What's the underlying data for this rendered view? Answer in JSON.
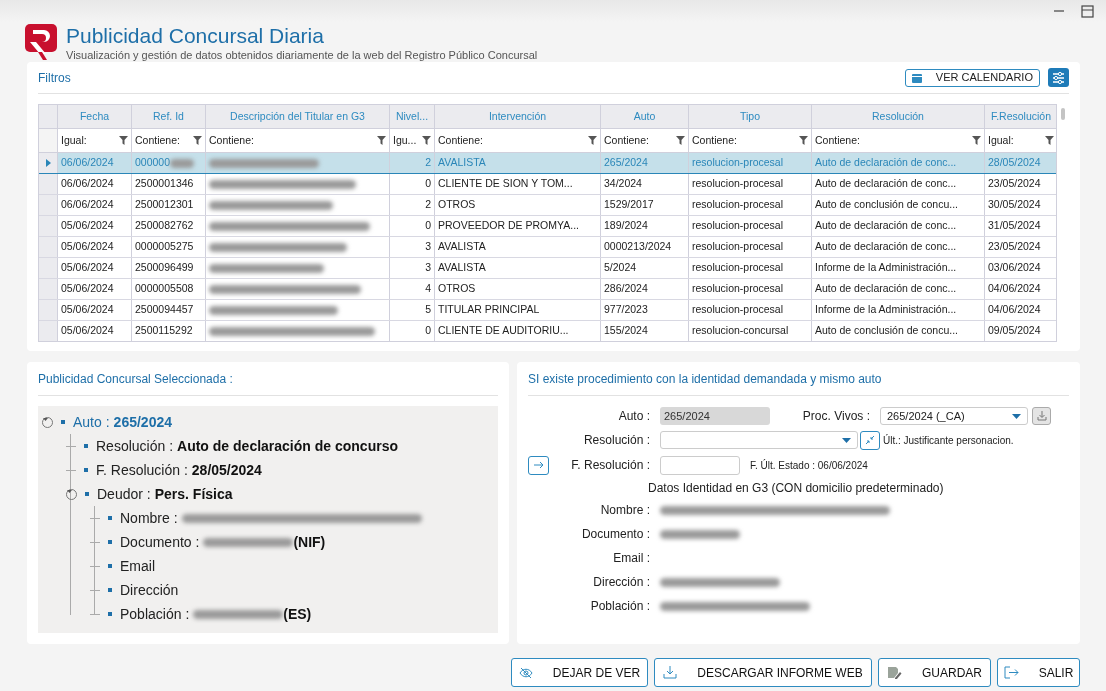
{
  "header": {
    "title": "Publicidad Concursal Diaria",
    "subtitle": "Visualización y gestión de datos obtenidos diariamente de la web del Registro Público Concursal"
  },
  "filters": {
    "title": "Filtros",
    "calendar_button": "VER CALENDARIO"
  },
  "table": {
    "columns": [
      {
        "label": "Fecha",
        "filter": "Igual:",
        "kind": "text"
      },
      {
        "label": "Ref. Id",
        "filter": "Contiene:",
        "kind": "text"
      },
      {
        "label": "Descripción del Titular en G3",
        "filter": "Contiene:",
        "kind": "redacted"
      },
      {
        "label": "Nivel...",
        "filter": "Igu...",
        "kind": "number"
      },
      {
        "label": "Intervención",
        "filter": "Contiene:",
        "kind": "text"
      },
      {
        "label": "Auto",
        "filter": "Contiene:",
        "kind": "text"
      },
      {
        "label": "Tipo",
        "filter": "Contiene:",
        "kind": "text"
      },
      {
        "label": "Resolución",
        "filter": "Contiene:",
        "kind": "text"
      },
      {
        "label": "F.Resolución",
        "filter": "Igual:",
        "kind": "text"
      }
    ],
    "rows": [
      {
        "selected": true,
        "ref_redacted": true,
        "cells": [
          "06/06/2024",
          "000000",
          null,
          "2",
          "AVALISTA",
          "265/2024",
          "resolucion-procesal",
          "Auto de declaración de conc...",
          "28/05/2024"
        ]
      },
      {
        "selected": false,
        "cells": [
          "06/06/2024",
          "2500001346",
          null,
          "0",
          "CLIENTE DE SION Y TOM...",
          "34/2024",
          "resolucion-procesal",
          "Auto de declaración de conc...",
          "23/05/2024"
        ]
      },
      {
        "selected": false,
        "cells": [
          "06/06/2024",
          "2500012301",
          null,
          "2",
          "OTROS",
          "1529/2017",
          "resolucion-procesal",
          "Auto de conclusión de concu...",
          "30/05/2024"
        ]
      },
      {
        "selected": false,
        "cells": [
          "05/06/2024",
          "2500082762",
          null,
          "0",
          "PROVEEDOR DE PROMYA...",
          "189/2024",
          "resolucion-procesal",
          "Auto de declaración de conc...",
          "31/05/2024"
        ]
      },
      {
        "selected": false,
        "cells": [
          "05/06/2024",
          "0000005275",
          null,
          "3",
          "AVALISTA",
          "0000213/2024",
          "resolucion-procesal",
          "Auto de declaración de conc...",
          "23/05/2024"
        ]
      },
      {
        "selected": false,
        "cells": [
          "05/06/2024",
          "2500096499",
          null,
          "3",
          "AVALISTA",
          "5/2024",
          "resolucion-procesal",
          "Informe de la Administración...",
          "03/06/2024"
        ]
      },
      {
        "selected": false,
        "cells": [
          "05/06/2024",
          "0000005508",
          null,
          "4",
          "OTROS",
          "286/2024",
          "resolucion-procesal",
          "Auto de declaración de conc...",
          "04/06/2024"
        ]
      },
      {
        "selected": false,
        "cells": [
          "05/06/2024",
          "2500094457",
          null,
          "5",
          "TITULAR PRINCIPAL",
          "977/2023",
          "resolucion-procesal",
          "Informe de la Administración...",
          "04/06/2024"
        ]
      },
      {
        "selected": false,
        "cells": [
          "05/06/2024",
          "2500115292",
          null,
          "0",
          "CLIENTE  DE  AUDITORIU...",
          "155/2024",
          "resolucion-concursal",
          "Auto de conclusión de concu...",
          "09/05/2024"
        ]
      }
    ]
  },
  "selected_panel": {
    "title": "Publicidad Concursal Seleccionada :",
    "tree": [
      {
        "label": "Auto :",
        "value": "265/2024",
        "expanded": true,
        "children": [
          {
            "label": "Resolución :",
            "value": "Auto de declaración de concurso"
          },
          {
            "label": "F. Resolución :",
            "value": "28/05/2024"
          },
          {
            "label": "Deudor :",
            "value": "Pers. Física",
            "expanded": true,
            "children": [
              {
                "label": "Nombre :",
                "redacted": true
              },
              {
                "label": "Documento :",
                "redacted": true,
                "value": "(NIF)"
              },
              {
                "label": "Email"
              },
              {
                "label": "Dirección"
              },
              {
                "label": "Población :",
                "redacted": true,
                "value": "(ES)"
              }
            ]
          }
        ]
      }
    ]
  },
  "procedure_panel": {
    "title": "SI existe procedimiento con la identidad demandada y mismo auto",
    "auto": {
      "label": "Auto :",
      "value": "265/2024",
      "disabled": true
    },
    "proc_vivos": {
      "label": "Proc. Vivos :",
      "value": "265/2024 (_CA)"
    },
    "resolucion": {
      "label": "Resolución :",
      "last": "Últ.: Justificante personacion."
    },
    "f_resolucion": {
      "label": "F. Resolución :",
      "last_state": "F. Últ. Estado : 06/06/2024"
    },
    "identity_title": "Datos Identidad en G3 (CON domicilio predeterminado)",
    "identity": [
      {
        "label": "Nombre :",
        "redacted": true
      },
      {
        "label": "Documento :",
        "redacted": true
      },
      {
        "label": "Email :"
      },
      {
        "label": "Dirección :",
        "redacted": true
      },
      {
        "label": "Población :",
        "redacted": true
      }
    ]
  },
  "buttons": [
    {
      "label": "DEJAR DE VER",
      "kind": "hide"
    },
    {
      "label": "DESCARGAR INFORME WEB",
      "kind": "download"
    },
    {
      "label": "GUARDAR",
      "kind": "save"
    },
    {
      "label": "SALIR",
      "kind": "exit"
    }
  ]
}
